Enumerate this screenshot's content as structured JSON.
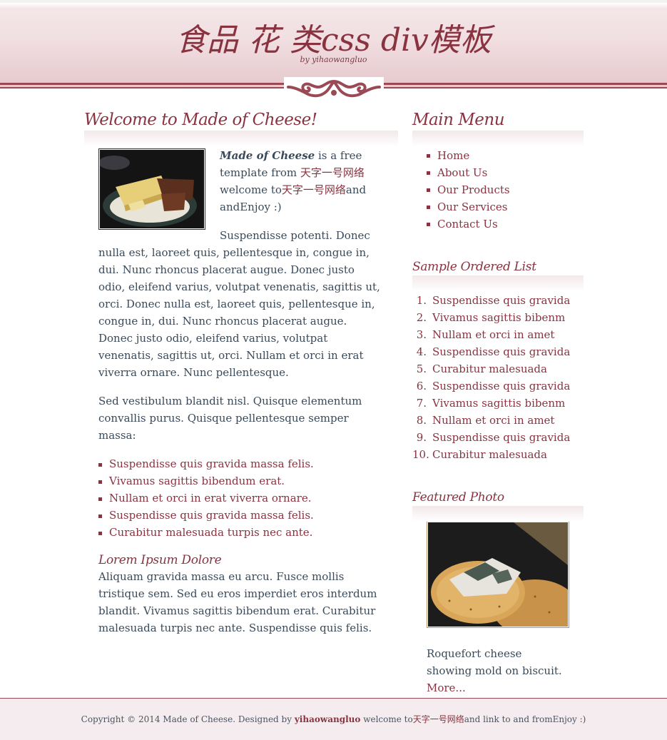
{
  "header": {
    "title": "食品 花 类css div模板",
    "subtitle": "by yihaowangluo"
  },
  "main": {
    "heading": "Welcome to Made of Cheese!",
    "intro_strong": "Made of Cheese",
    "intro_text1": " is a free template from ",
    "intro_link1": "天字一号网络",
    "intro_text2": " welcome to",
    "intro_link2": "天字一号网络",
    "intro_text3": "and andEnjoy :)",
    "para1": "Suspendisse potenti. Donec nulla est, laoreet quis, pellentesque in, congue in, dui. Nunc rhoncus placerat augue. Donec justo odio, eleifend varius, volutpat venenatis, sagittis ut, orci. Donec nulla est, laoreet quis, pellentesque in, congue in, dui. Nunc rhoncus placerat augue. Donec justo odio, eleifend varius, volutpat venenatis, sagittis ut, orci. Nullam et orci in erat viverra ornare. Nunc pellentesque.",
    "para2": "Sed vestibulum blandit nisl. Quisque elementum convallis purus. Quisque pellentesque semper massa:",
    "list": [
      "Suspendisse quis gravida massa felis.",
      "Vivamus sagittis bibendum erat.",
      "Nullam et orci in erat viverra ornare.",
      "Suspendisse quis gravida massa felis.",
      "Curabitur malesuada turpis nec ante."
    ],
    "subheading": "Lorem Ipsum Dolore",
    "para3": "Aliquam gravida massa eu arcu. Fusce mollis tristique sem. Sed eu eros imperdiet eros interdum blandit. Vivamus sagittis bibendum erat. Curabitur malesuada turpis nec ante. Suspendisse quis felis."
  },
  "sidebar": {
    "menu_heading": "Main Menu",
    "menu": [
      "Home",
      "About Us",
      "Our Products",
      "Our Services",
      "Contact Us"
    ],
    "ol_heading": "Sample Ordered List",
    "ol": [
      "Suspendisse quis gravida",
      "Vivamus sagittis bibenm",
      "Nullam et orci in amet",
      "Suspendisse quis gravida",
      "Curabitur malesuada",
      "Suspendisse quis gravida",
      "Vivamus sagittis bibenm",
      "Nullam et orci in amet",
      "Suspendisse quis gravida",
      "Curabitur malesuada"
    ],
    "ol_numbers": [
      "1.",
      "2.",
      "3.",
      "4.",
      "5.",
      "6.",
      "7.",
      "8.",
      "9.",
      "10."
    ],
    "photo_heading": "Featured Photo",
    "photo_caption": "Roquefort cheese showing mold on biscuit.",
    "photo_more": "More..."
  },
  "footer": {
    "text1": "Copyright © 2014 Made of Cheese. Designed by ",
    "designer": "yihaowangluo",
    "text2": " welcome to",
    "cn": "天字一号网络",
    "text3": "and link to and fromEnjoy :)"
  },
  "colors": {
    "accent": "#8a3340",
    "text": "#3a4a5a",
    "header_bg": "#f1dfe2",
    "footer_bg": "#f4ecee"
  }
}
